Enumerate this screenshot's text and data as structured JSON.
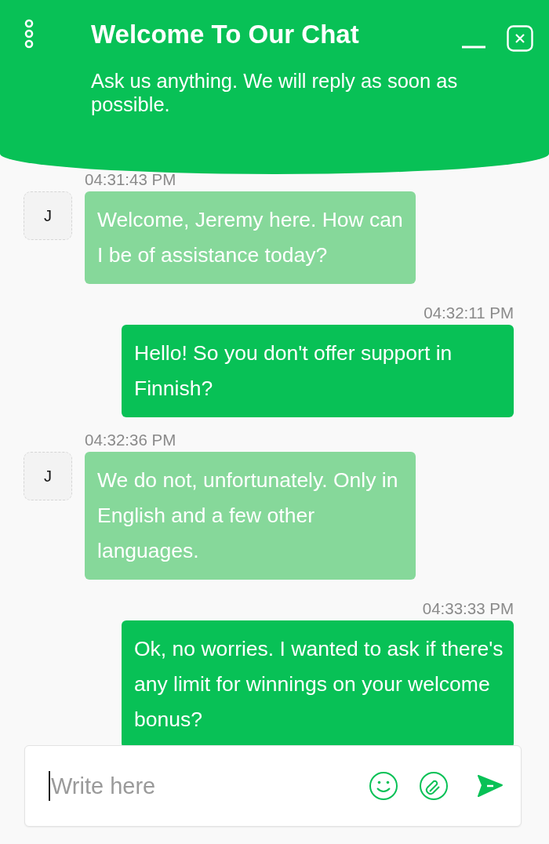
{
  "header": {
    "title": "Welcome To Our Chat",
    "subtitle": "Ask us anything. We will reply as soon as possible."
  },
  "messages": [
    {
      "kind": "agent",
      "avatar": "J",
      "time": "04:31:43 PM",
      "text": "Welcome, Jeremy here. How can I be of assistance today?"
    },
    {
      "kind": "user",
      "time": "04:32:11 PM",
      "text": "Hello! So you don't offer support in Finnish?"
    },
    {
      "kind": "agent",
      "avatar": "J",
      "time": "04:32:36 PM",
      "text": "We do not, unfortunately. Only in English and a few other languages."
    },
    {
      "kind": "user",
      "time": "04:33:33 PM",
      "text": "Ok, no worries. I wanted to ask if there's any limit for winnings on your welcome bonus?"
    }
  ],
  "composer": {
    "placeholder": "Write here"
  }
}
